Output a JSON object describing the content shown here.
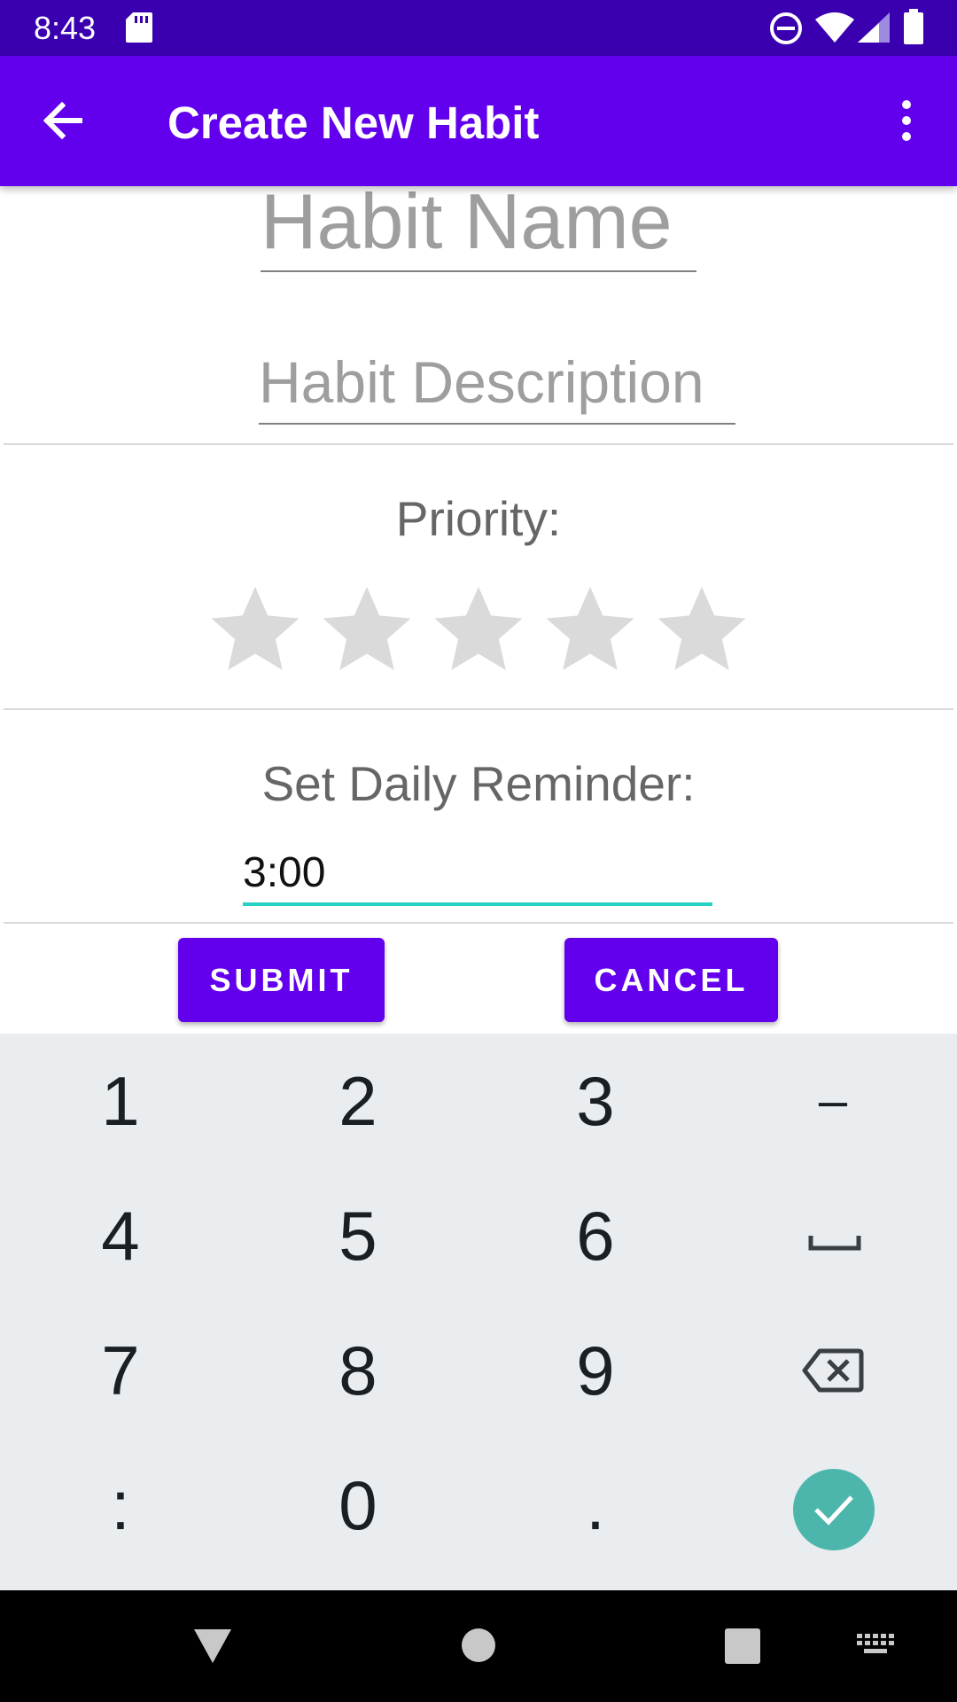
{
  "status_bar": {
    "time": "8:43",
    "icons": [
      "sd-card-icon",
      "do-not-disturb-icon",
      "wifi-icon",
      "cell-signal-icon",
      "battery-icon"
    ]
  },
  "app_bar": {
    "title": "Create New Habit",
    "back_icon": "arrow-back-icon",
    "menu_icon": "more-vert-icon"
  },
  "form": {
    "habit_name_placeholder": "Habit Name",
    "habit_name_value": "",
    "habit_description_placeholder": "Habit Description",
    "habit_description_value": "",
    "priority_label": "Priority:",
    "priority_rating": 0,
    "priority_max": 5,
    "reminder_label": "Set Daily Reminder:",
    "reminder_value": "3:00"
  },
  "buttons": {
    "submit": "SUBMIT",
    "cancel": "CANCEL"
  },
  "keyboard": {
    "rows": [
      [
        "1",
        "2",
        "3",
        "–"
      ],
      [
        "4",
        "5",
        "6",
        "space"
      ],
      [
        "7",
        "8",
        "9",
        "backspace"
      ],
      [
        ":",
        "0",
        ".",
        "done"
      ]
    ]
  },
  "nav_bar": {
    "icons": [
      "back-triangle-icon",
      "home-circle-icon",
      "recents-square-icon",
      "keyboard-switch-icon"
    ]
  },
  "colors": {
    "status_bar": "#3a00b0",
    "app_bar": "#6200ee",
    "accent": "#26d1c4",
    "star_empty": "#dadada",
    "done_key": "#4db6ac"
  }
}
